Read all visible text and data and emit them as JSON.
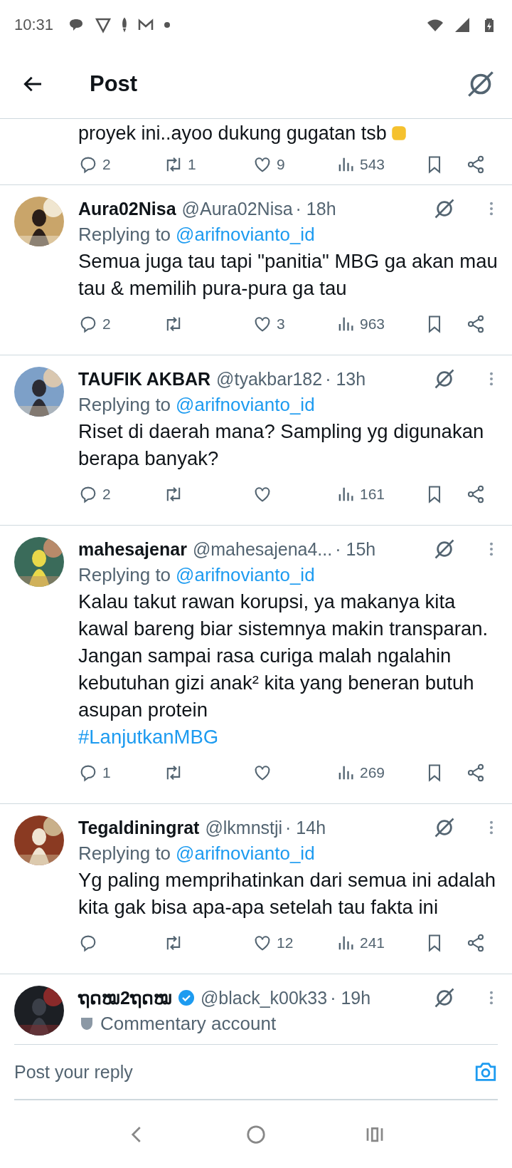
{
  "status_bar": {
    "time": "10:31"
  },
  "header": {
    "title": "Post"
  },
  "partial_post": {
    "text": "proyek ini..ayoo dukung gugatan tsb",
    "actions": {
      "replies": "2",
      "reposts": "1",
      "likes": "9",
      "views": "543"
    }
  },
  "replies": [
    {
      "name": "Aura02Nisa",
      "verified": false,
      "handle": "@Aura02Nisa",
      "time": "· 18h",
      "replying_label": "Replying to",
      "replying_to": "@arifnovianto_id",
      "text": "Semua juga tau tapi \"panitia\" MBG ga akan mau tau & memilih pura-pura ga tau",
      "actions": {
        "replies": "2",
        "likes": "3",
        "views": "963"
      }
    },
    {
      "name": "TAUFIK AKBAR",
      "verified": false,
      "handle": "@tyakbar182",
      "time": "· 13h",
      "replying_label": "Replying to",
      "replying_to": "@arifnovianto_id",
      "text": "Riset di daerah mana? Sampling yg digunakan berapa banyak?",
      "actions": {
        "replies": "2",
        "views": "161"
      }
    },
    {
      "name": "mahesajenar",
      "verified": false,
      "handle": "@mahesajena4...",
      "time": "· 15h",
      "replying_label": "Replying to",
      "replying_to": "@arifnovianto_id",
      "text": "Kalau takut rawan korupsi, ya makanya kita kawal bareng biar sistemnya makin transparan. Jangan sampai rasa curiga malah ngalahin kebutuhan gizi anak² kita yang beneran butuh asupan protein",
      "hashtag": "#LanjutkanMBG",
      "actions": {
        "replies": "1",
        "views": "269"
      }
    },
    {
      "name": "Tegaldiningrat",
      "verified": false,
      "handle": "@lkmnstji",
      "time": "· 14h",
      "replying_label": "Replying to",
      "replying_to": "@arifnovianto_id",
      "text": "Yg paling memprihatinkan dari semua ini adalah kita gak bisa apa-apa setelah tau fakta ini",
      "actions": {
        "likes": "12",
        "views": "241"
      }
    },
    {
      "name": "ຖດໝ2ຖດໝ",
      "verified": true,
      "handle": "@black_k00k33",
      "time": "· 19h",
      "label": "Commentary account"
    }
  ],
  "reply_bar": {
    "placeholder": "Post your reply"
  }
}
